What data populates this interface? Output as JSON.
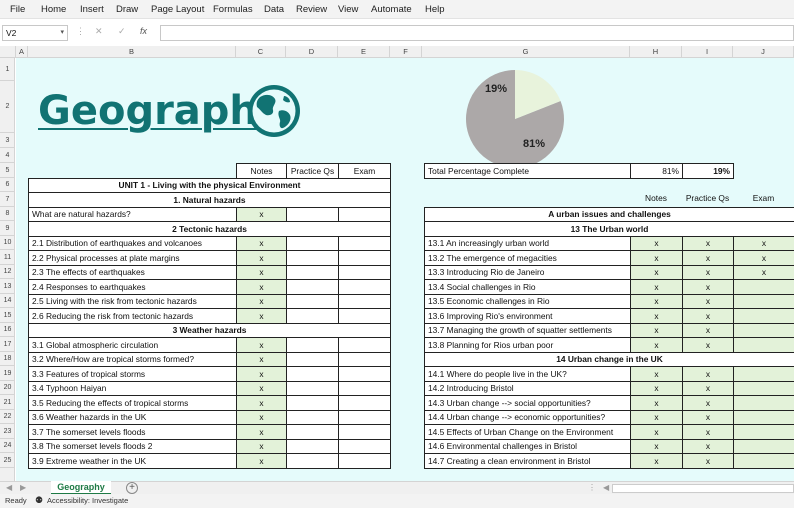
{
  "menu": [
    "File",
    "Home",
    "Insert",
    "Draw",
    "Page Layout",
    "Formulas",
    "Data",
    "Review",
    "View",
    "Automate",
    "Help"
  ],
  "formula_bar": {
    "name_box": "V2",
    "formula": ""
  },
  "columns": [
    "A",
    "B",
    "C",
    "D",
    "E",
    "F",
    "G",
    "H",
    "I",
    "J"
  ],
  "rows": [
    "1",
    "2",
    "3",
    "4",
    "5",
    "6",
    "7",
    "8",
    "9",
    "10",
    "11",
    "12",
    "13",
    "14",
    "15",
    "16",
    "17",
    "18",
    "19",
    "20",
    "21",
    "22",
    "23",
    "24",
    "25"
  ],
  "title": "Geography",
  "pie": {
    "complete_pct": "81%",
    "remaining_pct": "19%",
    "complete_color": "#aca8a8",
    "remaining_color": "#e8f3dc"
  },
  "left_table": {
    "headers": [
      "Notes",
      "Practice Qs",
      "Exam"
    ],
    "unit_title": "UNIT 1 - Living with the physical Environment",
    "rows": [
      {
        "type": "section",
        "label": "1. Natural hazards"
      },
      {
        "type": "item",
        "label": "What are natural hazards?",
        "notes": "x",
        "practice": "",
        "exam": ""
      },
      {
        "type": "section",
        "label": "2 Tectonic hazards"
      },
      {
        "type": "item",
        "label": "2.1 Distribution of earthquakes and volcanoes",
        "notes": "x",
        "practice": "",
        "exam": ""
      },
      {
        "type": "item",
        "label": "2.2 Physical processes at plate margins",
        "notes": "x",
        "practice": "",
        "exam": ""
      },
      {
        "type": "item",
        "label": "2.3 The effects of earthquakes",
        "notes": "x",
        "practice": "",
        "exam": ""
      },
      {
        "type": "item",
        "label": "2.4 Responses to earthquakes",
        "notes": "x",
        "practice": "",
        "exam": ""
      },
      {
        "type": "item",
        "label": "2.5 Living with the risk from tectonic hazards",
        "notes": "x",
        "practice": "",
        "exam": ""
      },
      {
        "type": "item",
        "label": "2.6 Reducing the risk from tectonic hazards",
        "notes": "x",
        "practice": "",
        "exam": ""
      },
      {
        "type": "section",
        "label": "3 Weather hazards"
      },
      {
        "type": "item",
        "label": "3.1 Global atmospheric circulation",
        "notes": "x",
        "practice": "",
        "exam": ""
      },
      {
        "type": "item",
        "label": "3.2 Where/How are tropical storms formed?",
        "notes": "x",
        "practice": "",
        "exam": ""
      },
      {
        "type": "item",
        "label": "3.3 Features of tropical storms",
        "notes": "x",
        "practice": "",
        "exam": ""
      },
      {
        "type": "item",
        "label": "3.4 Typhoon Haiyan",
        "notes": "x",
        "practice": "",
        "exam": ""
      },
      {
        "type": "item",
        "label": "3.5 Reducing the effects of tropical storms",
        "notes": "x",
        "practice": "",
        "exam": ""
      },
      {
        "type": "item",
        "label": "3.6 Weather hazards in the UK",
        "notes": "x",
        "practice": "",
        "exam": ""
      },
      {
        "type": "item",
        "label": "3.7 The somerset levels floods",
        "notes": "x",
        "practice": "",
        "exam": ""
      },
      {
        "type": "item",
        "label": "3.8 The somerset levels floods 2",
        "notes": "x",
        "practice": "",
        "exam": ""
      },
      {
        "type": "item",
        "label": "3.9 Extreme weather in the UK",
        "notes": "x",
        "practice": "",
        "exam": ""
      }
    ]
  },
  "right_table": {
    "total_label": "Total Percentage Complete",
    "total_notes": "81%",
    "total_value": "19%",
    "headers": [
      "Notes",
      "Practice Qs",
      "Exam"
    ],
    "unit_title": "A urban issues and challenges",
    "rows": [
      {
        "type": "section",
        "label": "13 The Urban world"
      },
      {
        "type": "item",
        "label": "13.1 An increasingly urban world",
        "notes": "x",
        "practice": "x",
        "exam": "x"
      },
      {
        "type": "item",
        "label": "13.2 The emergence of megacities",
        "notes": "x",
        "practice": "x",
        "exam": "x"
      },
      {
        "type": "item",
        "label": "13.3 Introducing Rio de Janeiro",
        "notes": "x",
        "practice": "x",
        "exam": "x"
      },
      {
        "type": "item",
        "label": "13.4 Social challenges in Rio",
        "notes": "x",
        "practice": "x",
        "exam": ""
      },
      {
        "type": "item",
        "label": "13.5 Economic challenges in Rio",
        "notes": "x",
        "practice": "x",
        "exam": ""
      },
      {
        "type": "item",
        "label": "13.6 Improving Rio's environment",
        "notes": "x",
        "practice": "x",
        "exam": ""
      },
      {
        "type": "item",
        "label": "13.7 Managing the growth of squatter settlements",
        "notes": "x",
        "practice": "x",
        "exam": ""
      },
      {
        "type": "item",
        "label": "13.8 Planning for Rios urban poor",
        "notes": "x",
        "practice": "x",
        "exam": ""
      },
      {
        "type": "section",
        "label": "14 Urban change in the UK"
      },
      {
        "type": "item",
        "label": "14.1 Where do people live in the UK?",
        "notes": "x",
        "practice": "x",
        "exam": ""
      },
      {
        "type": "item",
        "label": "14.2 Introducing Bristol",
        "notes": "x",
        "practice": "x",
        "exam": ""
      },
      {
        "type": "item",
        "label": "14.3 Urban change --> social opportunities?",
        "notes": "x",
        "practice": "x",
        "exam": ""
      },
      {
        "type": "item",
        "label": "14.4 Urban change --> economic opportunities?",
        "notes": "x",
        "practice": "x",
        "exam": ""
      },
      {
        "type": "item",
        "label": "14.5 Effects of Urban Change on the Environment",
        "notes": "x",
        "practice": "x",
        "exam": ""
      },
      {
        "type": "item",
        "label": "14.6 Environmental challenges in Bristol",
        "notes": "x",
        "practice": "x",
        "exam": ""
      },
      {
        "type": "item",
        "label": "14.7 Creating a clean environment in Bristol",
        "notes": "x",
        "practice": "x",
        "exam": ""
      }
    ]
  },
  "sheet_tab": "Geography",
  "status": {
    "ready": "Ready",
    "accessibility": "Accessibility: Investigate"
  },
  "icons": {
    "globe": "globe-icon",
    "function": "function-icon",
    "cancel": "cancel-icon",
    "confirm": "confirm-icon"
  }
}
